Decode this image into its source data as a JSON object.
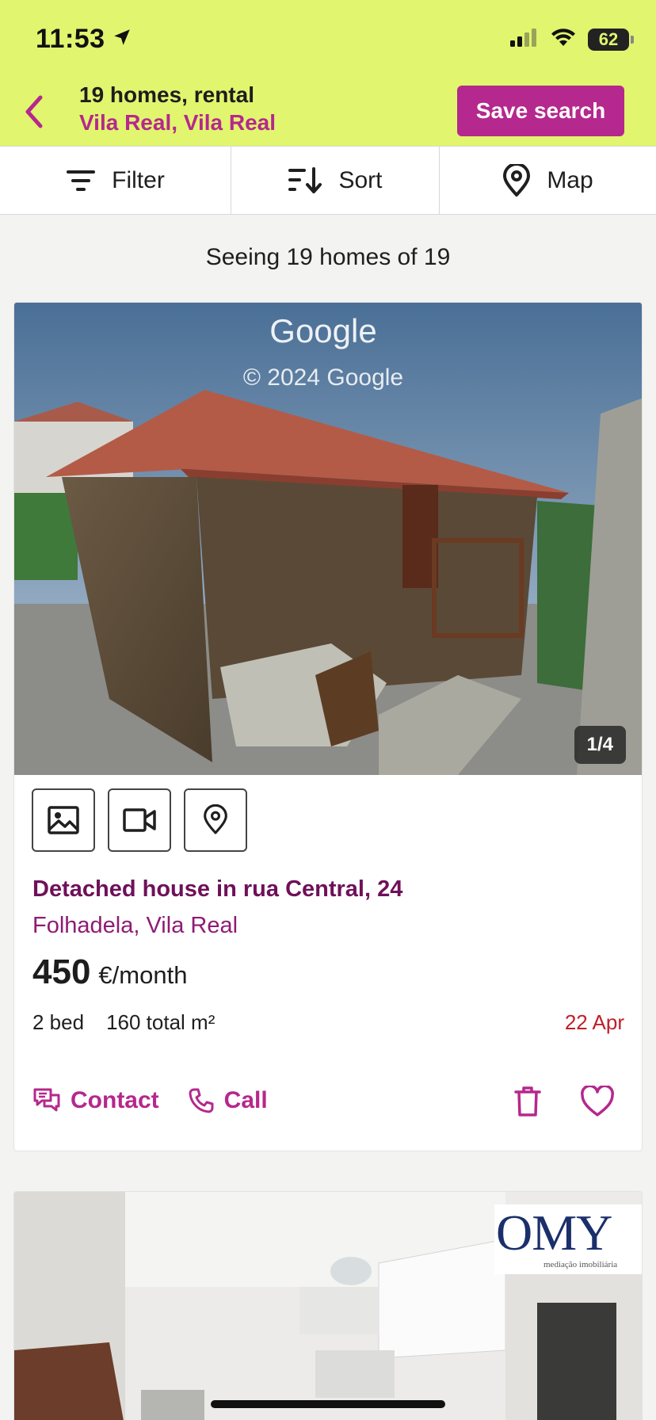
{
  "status_bar": {
    "time": "11:53",
    "battery": "62",
    "icons": [
      "location-arrow-icon",
      "signal-icon",
      "wifi-icon",
      "battery-icon"
    ]
  },
  "header": {
    "title": "19 homes, rental",
    "subtitle": "Vila Real, Vila Real",
    "save_label": "Save search",
    "colors": {
      "background": "#e1f56e",
      "accent": "#b5288d"
    }
  },
  "toolbar": {
    "filter_label": "Filter",
    "sort_label": "Sort",
    "map_label": "Map"
  },
  "results": {
    "summary": "Seeing 19 homes of 19"
  },
  "listings": [
    {
      "photo_watermark": "Google",
      "photo_copyright": "© 2024 Google",
      "photo_counter": "1/4",
      "media_buttons": [
        "photo-icon",
        "video-icon",
        "map-pin-icon"
      ],
      "title": "Detached house in rua Central, 24",
      "location": "Folhadela, Vila Real",
      "price": "450",
      "price_unit": "€/month",
      "beds": "2 bed",
      "area": "160 total m²",
      "date": "22 Apr",
      "contact_label": "Contact",
      "call_label": "Call"
    },
    {
      "logo_text": "OMY",
      "logo_subtext": "mediação imobiliária"
    }
  ]
}
